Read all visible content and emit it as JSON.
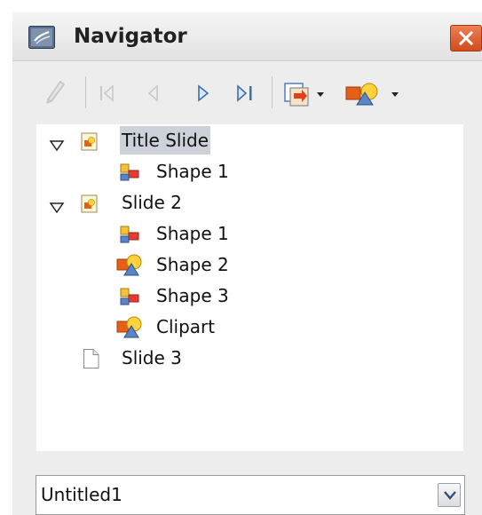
{
  "window": {
    "title": "Navigator",
    "close_icon": "close-icon",
    "accent": "#d9531e"
  },
  "toolbar": {
    "buttons": [
      {
        "name": "edit-icon",
        "enabled": false
      },
      {
        "name": "first-slide-icon",
        "enabled": false
      },
      {
        "name": "previous-slide-icon",
        "enabled": false
      },
      {
        "name": "next-slide-icon",
        "enabled": true
      },
      {
        "name": "last-slide-icon",
        "enabled": true
      },
      {
        "name": "drag-mode-icon",
        "enabled": true
      },
      {
        "name": "shapes-icon",
        "enabled": true
      }
    ]
  },
  "tree": {
    "items": [
      {
        "label": "Title Slide",
        "type": "slide",
        "expanded": true,
        "selected": true
      },
      {
        "label": "Shape 1",
        "type": "shape-basic"
      },
      {
        "label": "Slide 2",
        "type": "slide",
        "expanded": true
      },
      {
        "label": "Shape 1",
        "type": "shape-basic"
      },
      {
        "label": "Shape 2",
        "type": "shape-object"
      },
      {
        "label": "Shape 3",
        "type": "shape-basic"
      },
      {
        "label": "Clipart",
        "type": "shape-object"
      },
      {
        "label": "Slide 3",
        "type": "slide-blank"
      }
    ]
  },
  "document_select": {
    "value": "Untitled1"
  }
}
